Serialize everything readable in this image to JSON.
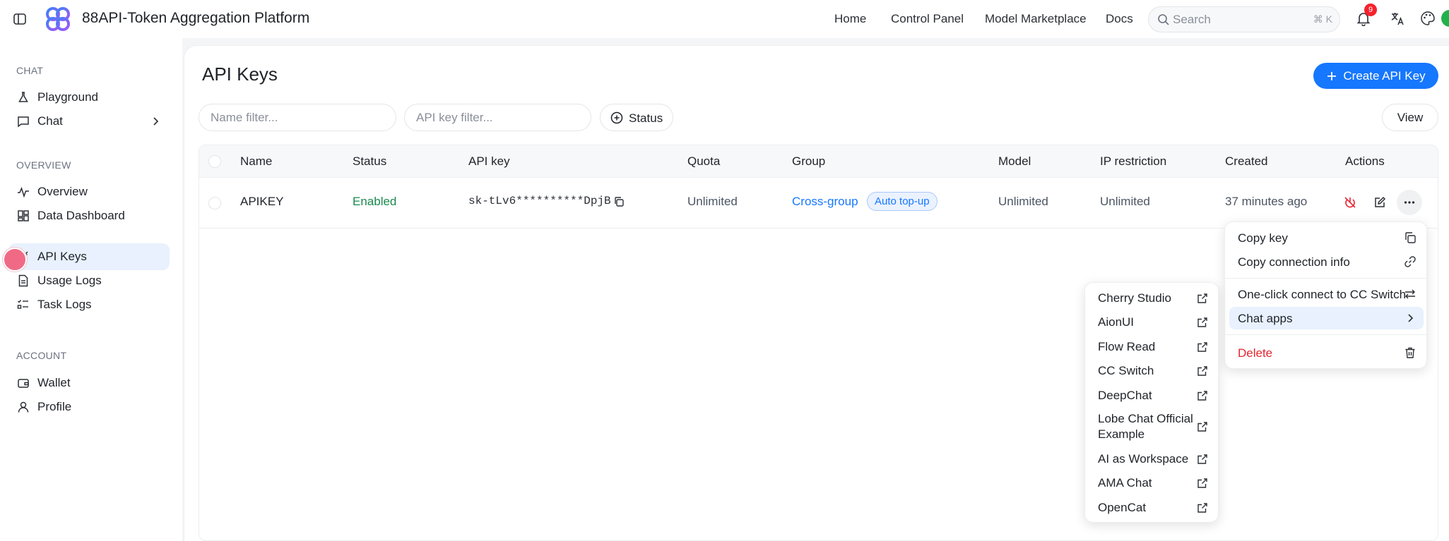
{
  "header": {
    "app_title": "88API-Token Aggregation Platform",
    "nav": [
      "Home",
      "Control Panel",
      "Model Marketplace",
      "Docs"
    ],
    "search_placeholder": "Search",
    "search_shortcut": "⌘ K",
    "notification_count": "9"
  },
  "sidebar": {
    "sections": [
      {
        "label": "CHAT",
        "items": [
          {
            "label": "Playground",
            "icon": "flask-icon"
          },
          {
            "label": "Chat",
            "icon": "chat-icon"
          }
        ]
      },
      {
        "label": "OVERVIEW",
        "items": [
          {
            "label": "Overview",
            "icon": "activity-icon"
          },
          {
            "label": "Data Dashboard",
            "icon": "dashboard-icon"
          },
          {
            "label": "API Keys",
            "icon": "key-icon"
          },
          {
            "label": "Usage Logs",
            "icon": "document-icon"
          },
          {
            "label": "Task Logs",
            "icon": "checklist-icon"
          }
        ]
      },
      {
        "label": "ACCOUNT",
        "items": [
          {
            "label": "Wallet",
            "icon": "wallet-icon"
          },
          {
            "label": "Profile",
            "icon": "user-icon"
          }
        ]
      }
    ],
    "active": "API Keys"
  },
  "page": {
    "title": "API Keys",
    "create_button": "Create API Key",
    "name_filter_placeholder": "Name filter...",
    "key_filter_placeholder": "API key filter...",
    "status_button": "Status",
    "view_button": "View"
  },
  "table": {
    "columns": [
      "Name",
      "Status",
      "API key",
      "Quota",
      "Group",
      "Model",
      "IP restriction",
      "Created",
      "Actions"
    ],
    "rows": [
      {
        "name": "APIKEY",
        "status": "Enabled",
        "api_key": "sk-tLv6**********DpjB",
        "quota": "Unlimited",
        "group": "Cross-group",
        "group_tag": "Auto top-up",
        "model": "Unlimited",
        "ip_restriction": "Unlimited",
        "created": "37 minutes ago"
      }
    ]
  },
  "actions_menu": {
    "items": [
      "Copy key",
      "Copy connection info",
      "One-click connect to CC Switch",
      "Chat apps",
      "Delete"
    ],
    "highlighted": "Chat apps"
  },
  "chat_apps_submenu": {
    "items": [
      "Cherry Studio",
      "AionUI",
      "Flow Read",
      "CC Switch",
      "DeepChat",
      "Lobe Chat Official Example",
      "AI as Workspace",
      "AMA Chat",
      "OpenCat"
    ]
  },
  "colors": {
    "accent": "#1677ff",
    "success": "#1a8a4e",
    "danger": "#e5262f"
  }
}
